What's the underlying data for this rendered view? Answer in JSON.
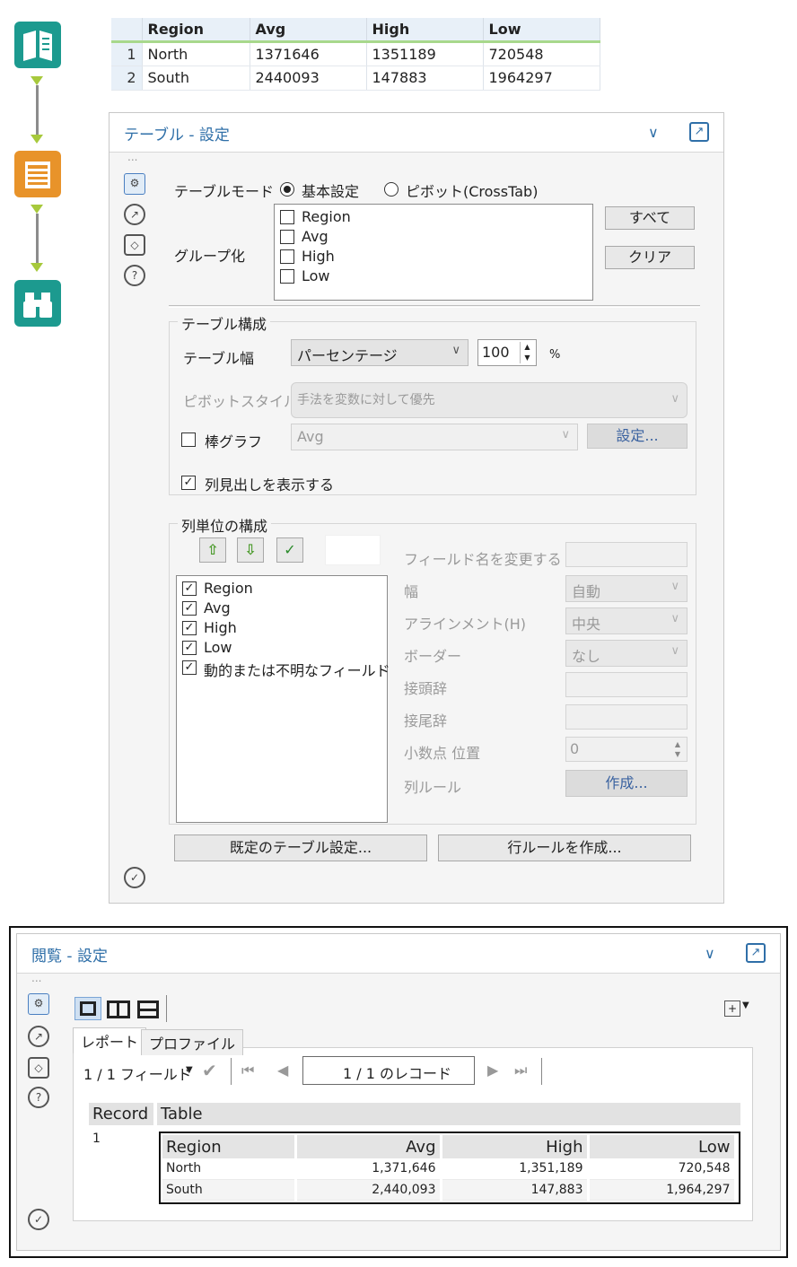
{
  "colors": {
    "accent": "#2f6fa8",
    "wf_book": "#1c9a8f",
    "wf_table": "#e8932a",
    "wf_browse": "#1c9a8f",
    "connector_arrow": "#a7c93c"
  },
  "workflow": {
    "icons": [
      "book-input-icon",
      "table-tool-icon",
      "browse-binoculars-icon"
    ]
  },
  "grid": {
    "headers": [
      "Region",
      "Avg",
      "High",
      "Low"
    ],
    "rows": [
      {
        "num": "1",
        "cells": [
          "North",
          "1371646",
          "1351189",
          "720548"
        ]
      },
      {
        "num": "2",
        "cells": [
          "South",
          "2440093",
          "147883",
          "1964297"
        ]
      }
    ]
  },
  "table_panel": {
    "title": "テーブル - 設定",
    "mode_label": "テーブルモード",
    "mode_basic": "基本設定",
    "mode_pivot": "ピボット(CrossTab)",
    "group_label": "グループ化",
    "group_fields": [
      "Region",
      "Avg",
      "High",
      "Low"
    ],
    "btn_all": "すべて",
    "btn_clear": "クリア",
    "config_title": "テーブル構成",
    "width_label": "テーブル幅",
    "width_type": "パーセンテージ",
    "width_value": "100",
    "width_unit": "%",
    "pivot_style_label": "ピボットスタイル",
    "pivot_style_value": "手法を変数に対して優先",
    "bar_label": "棒グラフ",
    "bar_field": "Avg",
    "bar_settings": "設定...",
    "show_headers_label": "列見出しを表示する",
    "column_config_title": "列単位の構成",
    "column_fields": [
      "Region",
      "Avg",
      "High",
      "Low",
      "動的または不明なフィールド"
    ],
    "rename_label": "フィールド名を変更する",
    "width_col_label": "幅",
    "width_col_value": "自動",
    "align_label": "アラインメント(H)",
    "align_value": "中央",
    "border_label": "ボーダー",
    "border_value": "なし",
    "prefix_label": "接頭辞",
    "suffix_label": "接尾辞",
    "decimal_label": "小数点 位置",
    "decimal_value": "0",
    "col_rule_label": "列ルール",
    "col_rule_btn": "作成...",
    "default_btn": "既定のテーブル設定...",
    "row_rule_btn": "行ルールを作成..."
  },
  "browse_panel": {
    "title": "閲覧 - 設定",
    "tab_report": "レポート",
    "tab_profile": "プロファイル",
    "fields_count": "1 / 1 フィールド",
    "record_nav": "1 / 1 のレコード",
    "record_head": "Record",
    "table_head": "Table",
    "record_num": "1",
    "result_headers": [
      "Region",
      "Avg",
      "High",
      "Low"
    ],
    "result_rows": [
      [
        "North",
        "1,371,646",
        "1,351,189",
        "720,548"
      ],
      [
        "South",
        "2,440,093",
        "147,883",
        "1,964,297"
      ]
    ]
  }
}
